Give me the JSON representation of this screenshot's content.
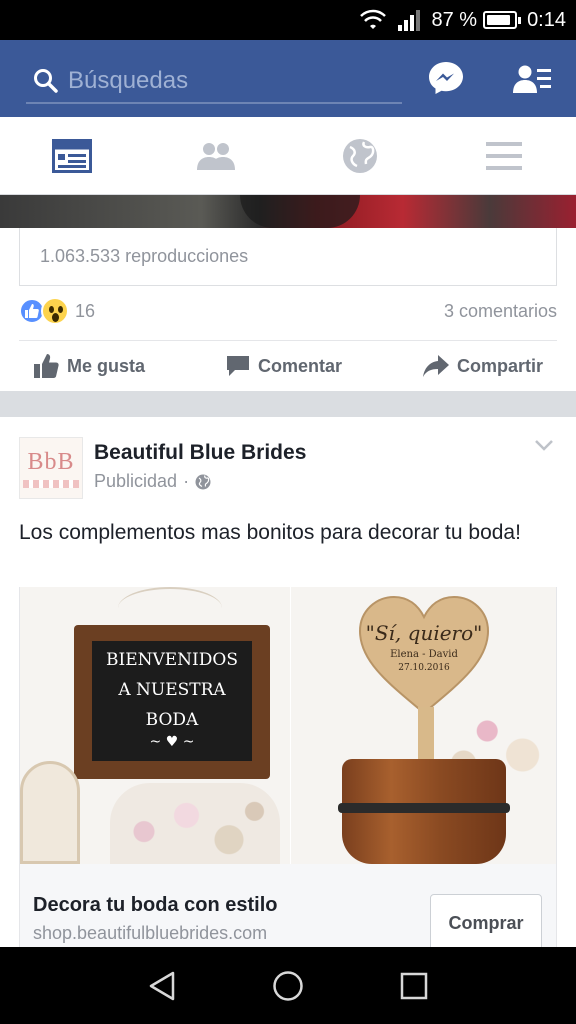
{
  "status_bar": {
    "battery_percent": "87 %",
    "battery_level": 0.87,
    "time": "0:14"
  },
  "header": {
    "search_placeholder": "Búsquedas"
  },
  "tabs": [
    {
      "icon": "news-feed-icon",
      "active": true
    },
    {
      "icon": "friends-icon",
      "active": false
    },
    {
      "icon": "notifications-globe-icon",
      "active": false
    },
    {
      "icon": "menu-icon",
      "active": false
    }
  ],
  "previous_post": {
    "views": "1.063.533 reproducciones",
    "reaction_count": "16",
    "comments": "3 comentarios",
    "actions": {
      "like": "Me gusta",
      "comment": "Comentar",
      "share": "Compartir"
    }
  },
  "ad_post": {
    "logo_text": "BbB",
    "page_name": "Beautiful Blue Brides",
    "sponsored": "Publicidad",
    "text": "Los complementos mas bonitos para decorar tu boda!",
    "image": {
      "chalkboard_lines": [
        "BIENVENIDOS",
        "A NUESTRA",
        "BODA"
      ],
      "heart_line1": "\"Sí, quiero\"",
      "heart_line2": "Elena - David",
      "heart_line3": "27.10.2016"
    },
    "cta_title": "Decora tu boda con estilo",
    "cta_domain": "shop.beautifulbluebrides.com",
    "cta_button": "Comprar"
  },
  "colors": {
    "facebook_blue": "#3b5998",
    "text_dark": "#1d2129",
    "text_gray": "#90949c"
  }
}
